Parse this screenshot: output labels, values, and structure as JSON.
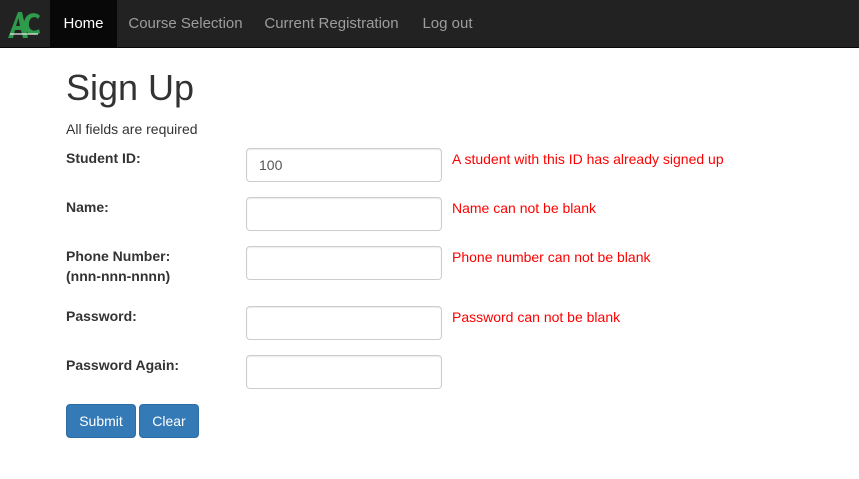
{
  "nav": {
    "items": [
      {
        "label": "Home",
        "active": true
      },
      {
        "label": "Course Selection",
        "active": false
      },
      {
        "label": "Current Registration",
        "active": false
      },
      {
        "label": "Log out",
        "active": false
      }
    ],
    "logo_icon": "ac-logo-icon",
    "logo_color": "#2e9b4a",
    "bar_color": "#222222"
  },
  "page": {
    "title": "Sign Up",
    "note": "All fields are required"
  },
  "form": {
    "student_id": {
      "label": "Student ID:",
      "value": "100",
      "error": "A student with this ID has already signed up"
    },
    "name": {
      "label": "Name:",
      "value": "",
      "error": "Name can not be blank"
    },
    "phone": {
      "label_line1": "Phone Number:",
      "label_line2": "(nnn-nnn-nnnn)",
      "value": "",
      "error": "Phone number can not be blank"
    },
    "password": {
      "label": "Password:",
      "value": "",
      "error": "Password can not be blank"
    },
    "password_again": {
      "label": "Password Again:",
      "value": ""
    }
  },
  "buttons": {
    "submit_label": "Submit",
    "clear_label": "Clear",
    "primary_color": "#337ab7"
  },
  "colors": {
    "error": "#ff0000"
  }
}
